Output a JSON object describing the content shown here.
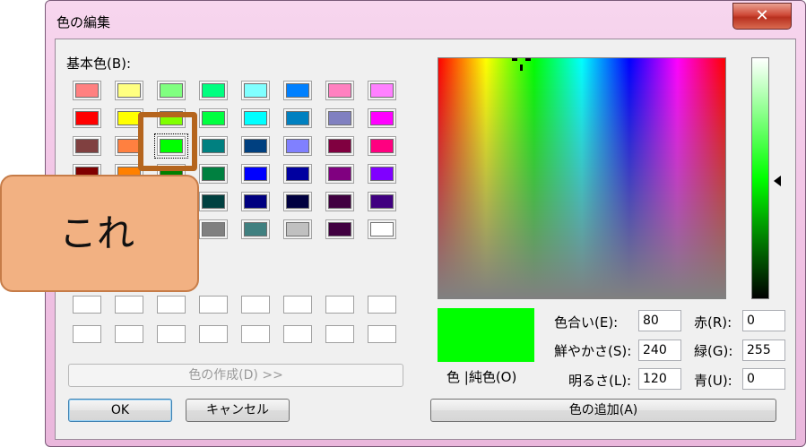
{
  "window": {
    "title": "色の編集",
    "close_glyph": "✕"
  },
  "basic_colors": {
    "label": "基本色(B):",
    "rows": [
      [
        "#ff8080",
        "#ffff80",
        "#80ff80",
        "#00ff80",
        "#80ffff",
        "#0080ff",
        "#ff80c0",
        "#ff80ff"
      ],
      [
        "#ff0000",
        "#ffff00",
        "#80ff00",
        "#00ff40",
        "#00ffff",
        "#0080c0",
        "#8080c0",
        "#ff00ff"
      ],
      [
        "#804040",
        "#ff8040",
        "#00ff00",
        "#008080",
        "#004080",
        "#8080ff",
        "#800040",
        "#ff0080"
      ],
      [
        "#800000",
        "#ff8000",
        "#008000",
        "#008040",
        "#0000ff",
        "#0000a0",
        "#800080",
        "#8000ff"
      ],
      [
        "#400000",
        "#804000",
        "#004000",
        "#004040",
        "#000080",
        "#000040",
        "#400040",
        "#400080"
      ],
      [
        "#000000",
        "#808000",
        "#808040",
        "#808080",
        "#408080",
        "#c0c0c0",
        "#400040",
        "#ffffff"
      ]
    ],
    "selected": {
      "row": 2,
      "col": 2
    }
  },
  "custom_colors": {
    "rows": 2,
    "cols": 8
  },
  "buttons": {
    "define_custom": "色の作成(D) >>",
    "ok": "OK",
    "cancel": "キャンセル",
    "add_custom": "色の追加(A)"
  },
  "preview": {
    "color": "#00ff00",
    "label": "色 |純色(O)"
  },
  "hsl": {
    "hue_label": "色合い(E):",
    "hue": "80",
    "sat_label": "鮮やかさ(S):",
    "sat": "240",
    "lum_label": "明るさ(L):",
    "lum": "120"
  },
  "rgb": {
    "red_label": "赤(R):",
    "red": "0",
    "green_label": "緑(G):",
    "green": "255",
    "blue_label": "青(U):",
    "blue": "0"
  },
  "annotation": {
    "text": "これ",
    "frame_color": "#b5651d",
    "bubble_color": "#f2b182"
  }
}
